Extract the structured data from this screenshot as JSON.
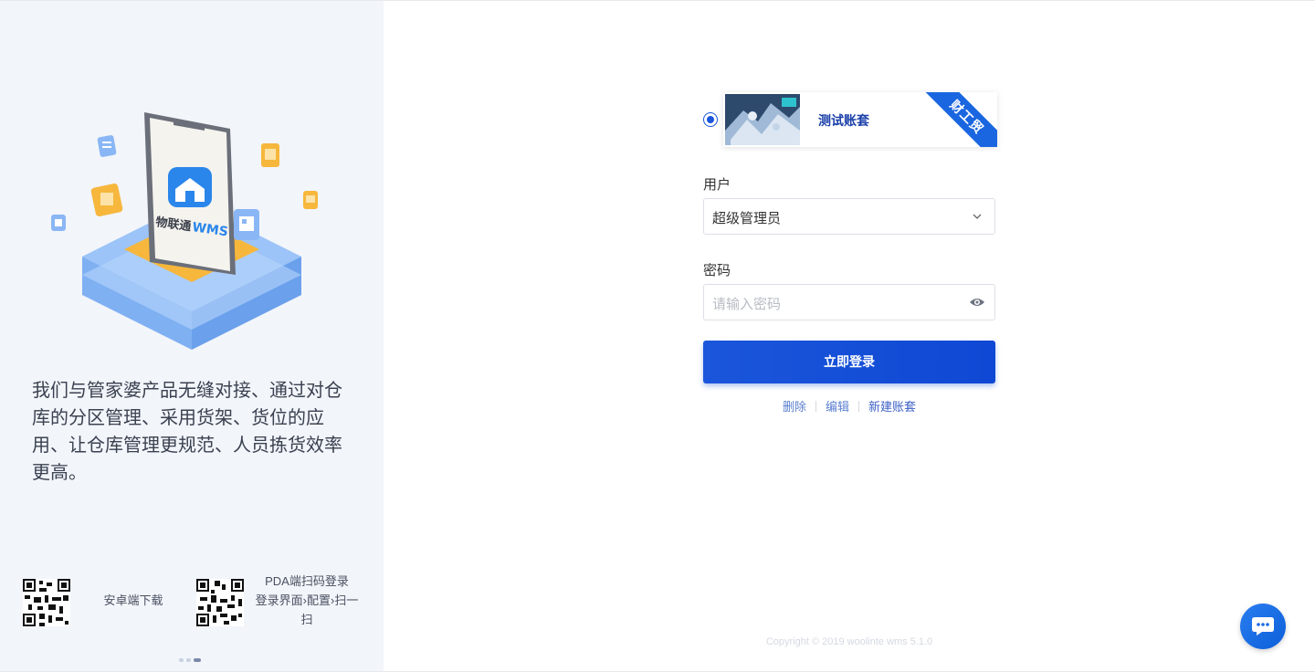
{
  "left_panel": {
    "illustration_brand": "物联通",
    "illustration_product": "WMS",
    "promo_text": "我们与管家婆产品无缝对接、通过对仓库的分区管理、采用货架、货位的应用、让仓库管理更规范、人员拣货效率更高。",
    "qr_android_label": "安卓端下载",
    "qr_pda_label_line1": "PDA端扫码登录",
    "qr_pda_label_line2": "登录界面›配置›扫一扫"
  },
  "account": {
    "name": "测试账套",
    "ribbon": "财工贸",
    "selected": true
  },
  "user_field": {
    "label": "用户",
    "value": "超级管理员"
  },
  "password_field": {
    "label": "密码",
    "placeholder": "请输入密码"
  },
  "login_button": {
    "label": "立即登录"
  },
  "links": {
    "delete": "删除",
    "edit": "编辑",
    "new_account": "新建账套"
  },
  "footer": {
    "copyright": "Copyright © 2019 woolinte wms 5.1.0"
  },
  "colors": {
    "primary": "#1a56db",
    "left_bg": "#f2f5fa",
    "link": "#5b7fd0"
  }
}
